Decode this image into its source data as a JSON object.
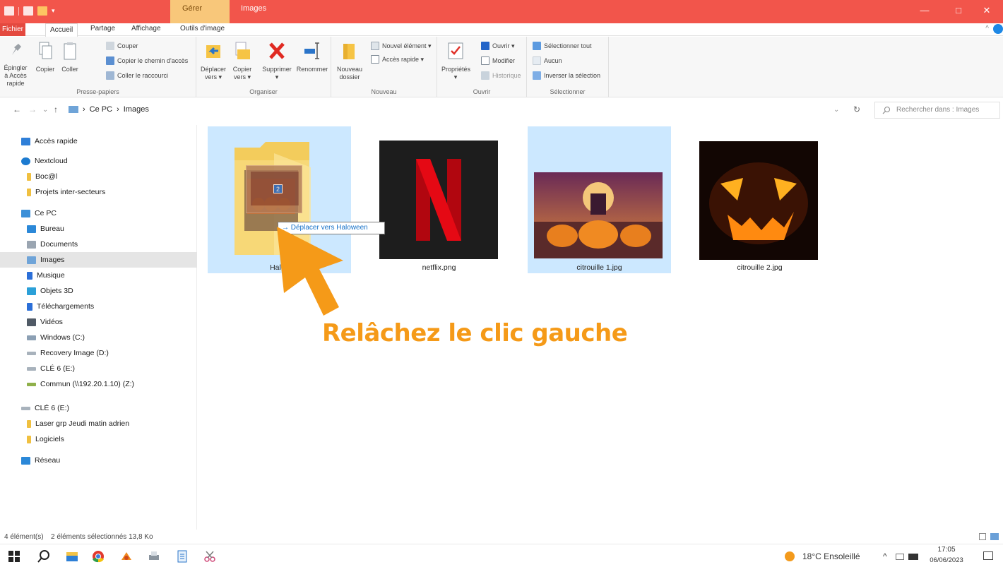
{
  "window": {
    "contextual_tab": "Gérer",
    "title": "Images",
    "controls": {
      "minimize": "—",
      "maximize": "□",
      "close": "✕"
    }
  },
  "ribbon_tabs": [
    "Fichier",
    "Accueil",
    "Partage",
    "Affichage",
    "Outils d'image"
  ],
  "ribbon": {
    "clipboard": {
      "pin_label": "Épingler à Accès rapide",
      "copy_label": "Copier",
      "paste_label": "Coller",
      "cut_label": "Couper",
      "copy_path_label": "Copier le chemin d'accès",
      "paste_shortcut_label": "Coller le raccourci",
      "group_label": "Presse-papiers"
    },
    "organize": {
      "move_label": "Déplacer vers ▾",
      "copyto_label": "Copier vers ▾",
      "delete_label": "Supprimer ▾",
      "rename_label": "Renommer",
      "group_label": "Organiser"
    },
    "new": {
      "new_folder_label": "Nouveau dossier",
      "new_item_label": "Nouvel élément ▾",
      "easy_access_label": "Accès rapide ▾",
      "group_label": "Nouveau"
    },
    "open": {
      "properties_label": "Propriétés ▾",
      "open_label": "Ouvrir ▾",
      "edit_label": "Modifier",
      "history_label": "Historique",
      "group_label": "Ouvrir"
    },
    "select": {
      "select_all_label": "Sélectionner tout",
      "select_none_label": "Aucun",
      "invert_label": "Inverser la sélection",
      "group_label": "Sélectionner"
    }
  },
  "address": {
    "back": "←",
    "forward": "→",
    "recent": "⌄",
    "up": "↑",
    "separator": "›",
    "crumbs": [
      "Ce PC",
      "Images"
    ],
    "dropdown": "⌄",
    "refresh": "↻",
    "search_placeholder": "Rechercher dans : Images"
  },
  "sidebar": [
    {
      "label": "Accès rapide",
      "icon": "star-icon",
      "color": "#2f7fd8"
    },
    {
      "label": "Nextcloud",
      "icon": "cloud-icon",
      "color": "#1d7bd0"
    },
    {
      "label": "Boc@l",
      "icon": "folder-icon",
      "color": "#f0c040"
    },
    {
      "label": "Projets inter-secteurs",
      "icon": "folder-icon",
      "color": "#f0c040"
    },
    {
      "label": "Ce PC",
      "icon": "computer-icon",
      "color": "#3b8fd8"
    },
    {
      "label": "Bureau",
      "icon": "desktop-icon",
      "color": "#2b88d8"
    },
    {
      "label": "Documents",
      "icon": "documents-icon",
      "color": "#9aa5b1"
    },
    {
      "label": "Images",
      "icon": "pictures-icon",
      "color": "#6fa4d8"
    },
    {
      "label": "Musique",
      "icon": "music-icon",
      "color": "#2b6fd8"
    },
    {
      "label": "Objets 3D",
      "icon": "cube-icon",
      "color": "#2ba0d8"
    },
    {
      "label": "Téléchargements",
      "icon": "download-icon",
      "color": "#2b6fd8"
    },
    {
      "label": "Vidéos",
      "icon": "video-icon",
      "color": "#505a66"
    },
    {
      "label": "Windows (C:)",
      "icon": "drive-icon",
      "color": "#8ca0b4"
    },
    {
      "label": "Recovery Image (D:)",
      "icon": "drive-icon",
      "color": "#a8b2bc"
    },
    {
      "label": "CLÉ 6 (E:)",
      "icon": "usb-drive-icon",
      "color": "#a8b2bc"
    },
    {
      "label": "Commun (\\\\192.20.1.10) (Z:)",
      "icon": "network-drive-icon",
      "color": "#8fb04a"
    },
    {
      "label": "CLÉ 6 (E:)",
      "icon": "usb-drive-icon",
      "color": "#a8b2bc"
    },
    {
      "label": "Laser grp Jeudi matin adrien",
      "icon": "folder-icon",
      "color": "#f0c040"
    },
    {
      "label": "Logiciels",
      "icon": "folder-icon",
      "color": "#f0c040"
    },
    {
      "label": "Réseau",
      "icon": "network-icon",
      "color": "#2b88d8"
    }
  ],
  "files": [
    {
      "name": "Haloween",
      "visible_label": "Halov",
      "kind": "folder",
      "selected": true
    },
    {
      "name": "netflix.png",
      "kind": "image",
      "selected": false
    },
    {
      "name": "citrouille 1.jpg",
      "kind": "image",
      "selected": true
    },
    {
      "name": "citrouille 2.jpg",
      "kind": "image",
      "selected": false
    }
  ],
  "drag": {
    "count_badge": "2",
    "tooltip": "→ Déplacer vers Haloween"
  },
  "instruction": "Relâchez le clic gauche",
  "status": {
    "count": "4 élément(s)",
    "selection": "2 éléments sélectionnés  13,8 Ko"
  },
  "taskbar": {
    "weather": "18°C  Ensoleillé",
    "time": "17:05",
    "date": "06/06/2023",
    "tray_arrow": "^"
  }
}
